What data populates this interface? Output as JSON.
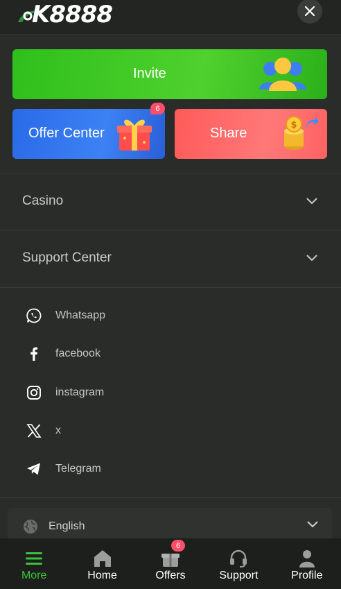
{
  "header": {
    "logo_text": "K8888",
    "brand_colors": {
      "logo_green": "#2e8b3c",
      "background": "#232523"
    }
  },
  "promo_cards": {
    "invite_label": "Invite",
    "offer_label": "Offer Center",
    "offer_badge": "6",
    "share_label": "Share",
    "colors": {
      "invite": "#3cc526",
      "offer": "#3478f0",
      "share": "#ff6b6b"
    }
  },
  "menu": {
    "casino_label": "Casino",
    "support_label": "Support Center"
  },
  "social": {
    "items": [
      {
        "label": "Whatsapp",
        "icon": "whatsapp-icon"
      },
      {
        "label": "facebook",
        "icon": "facebook-icon"
      },
      {
        "label": "instagram",
        "icon": "instagram-icon"
      },
      {
        "label": "x",
        "icon": "x-icon"
      },
      {
        "label": "Telegram",
        "icon": "telegram-icon"
      }
    ]
  },
  "language": {
    "selected": "English",
    "icon": "globe-icon"
  },
  "bottom_nav": {
    "items": [
      {
        "label": "More",
        "icon": "menu-icon",
        "active": true
      },
      {
        "label": "Home",
        "icon": "home-icon"
      },
      {
        "label": "Offers",
        "icon": "gift-icon",
        "badge": "6"
      },
      {
        "label": "Support",
        "icon": "headset-icon"
      },
      {
        "label": "Profile",
        "icon": "user-icon"
      }
    ],
    "active_color": "#3cc23a"
  }
}
